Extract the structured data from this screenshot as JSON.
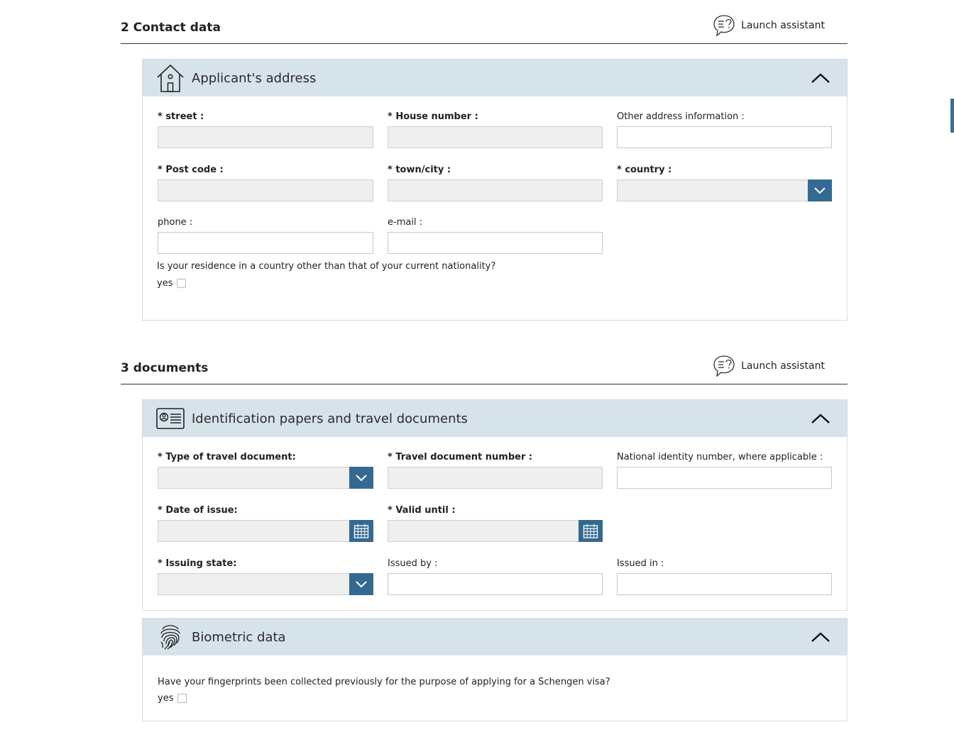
{
  "sections": {
    "contact": {
      "title": "2 Contact data",
      "assistant_label": "Launch assistant"
    },
    "documents": {
      "title": "3 documents",
      "assistant_label": "Launch assistant"
    }
  },
  "address_panel": {
    "title": "Applicant's address",
    "street_label": "* street :",
    "house_number_label": "* House number :",
    "other_info_label": "Other address information :",
    "post_code_label": "* Post code :",
    "town_label": "* town/city :",
    "country_label": "* country :",
    "phone_label": "phone :",
    "email_label": "e-mail :",
    "residence_question": "Is your residence in a country other than that of your current nationality?",
    "residence_yes": "yes"
  },
  "id_panel": {
    "title": "Identification papers and travel documents",
    "doc_type_label": "* Type of travel document:",
    "doc_number_label": "* Travel document number :",
    "national_id_label": "National identity number, where applicable :",
    "date_issue_label": "* Date of issue:",
    "valid_until_label": "* Valid until :",
    "issuing_state_label": "* Issuing state:",
    "issued_by_label": "Issued by :",
    "issued_in_label": "Issued in :"
  },
  "biometric_panel": {
    "title": "Biometric data",
    "fingerprint_question": "Have your fingerprints been collected previously for the purpose of applying for a Schengen visa?",
    "fingerprint_yes": "yes"
  },
  "colors": {
    "panel_header": "#d7e3eb",
    "accent": "#346a91",
    "disabled_input": "#efefef"
  },
  "icons": {
    "assistant": "speech-bubble-question-icon",
    "address": "house-icon",
    "id": "id-card-icon",
    "biometric": "fingerprint-icon",
    "collapse": "chevron-up-icon",
    "dropdown": "chevron-down-icon",
    "date": "calendar-icon"
  }
}
